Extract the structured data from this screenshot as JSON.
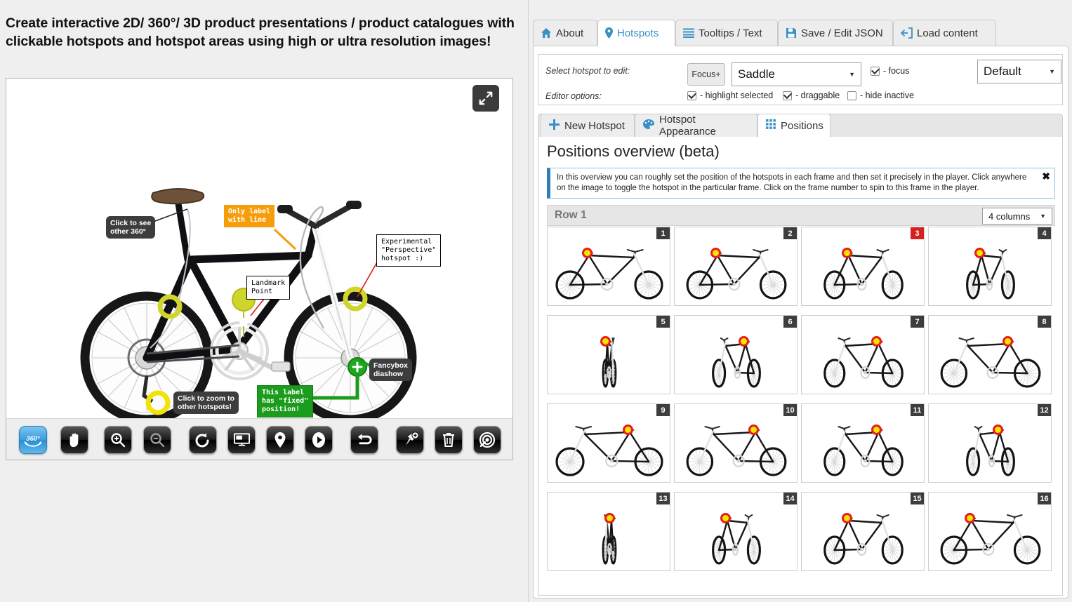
{
  "headline": "Create interactive 2D/ 360°/ 3D product presentations / product catalogues with clickable hotspots and hotspot areas using high or ultra resolution images!",
  "viewer": {
    "fullscreen_icon": "expand-arrows-icon",
    "toolbar": [
      {
        "name": "rotate-360-button",
        "icon": "360-icon",
        "active": true
      },
      {
        "name": "pan-hand-button",
        "icon": "hand-icon",
        "active": false
      },
      {
        "name": "zoom-in-button",
        "icon": "magnifier-plus-icon",
        "active": false
      },
      {
        "name": "zoom-out-button",
        "icon": "magnifier-minus-icon",
        "active": false
      },
      {
        "name": "reset-rotate-button",
        "icon": "rotate-ccw-icon",
        "active": false
      },
      {
        "name": "fullscreen-monitor-button",
        "icon": "monitor-icon",
        "active": false
      },
      {
        "name": "hotspots-toggle-button",
        "icon": "map-pin-icon",
        "active": false
      },
      {
        "name": "play-button",
        "icon": "play-icon",
        "active": false
      },
      {
        "name": "undo-button",
        "icon": "undo-arrow-icon",
        "active": false
      },
      {
        "name": "add-hotspot-button",
        "icon": "pin-plus-icon",
        "active": false
      },
      {
        "name": "delete-button",
        "icon": "trash-icon",
        "active": false
      },
      {
        "name": "target-focus-button",
        "icon": "target-spiral-icon",
        "active": false
      }
    ],
    "labels": [
      {
        "name": "hotspot-label-click-360",
        "text": "Click to see\nother 360°",
        "style": "dark"
      },
      {
        "name": "hotspot-label-only-label-with-line",
        "text": "Only label\nwith line",
        "style": "orange"
      },
      {
        "name": "hotspot-label-landmark-point",
        "text": "Landmark\nPoint",
        "style": "white"
      },
      {
        "name": "hotspot-label-perspective",
        "text": "Experimental\n\"Perspective\"\nhotspot :)",
        "style": "white"
      },
      {
        "name": "hotspot-label-fancybox",
        "text": "Fancybox\ndiashow",
        "style": "dark"
      },
      {
        "name": "hotspot-label-click-zoom",
        "text": "Click to zoom to\nother hotspots!",
        "style": "dark"
      },
      {
        "name": "hotspot-label-fixed-position",
        "text": "This label\nhas \"fixed\"\nposition!",
        "style": "green"
      }
    ]
  },
  "tabs": [
    {
      "label": "About",
      "icon": "home-icon",
      "selected": false
    },
    {
      "label": "Hotspots",
      "icon": "map-pin-icon",
      "selected": true
    },
    {
      "label": "Tooltips / Text",
      "icon": "list-lines-icon",
      "selected": false
    },
    {
      "label": "Save / Edit JSON",
      "icon": "floppy-disk-icon",
      "selected": false
    },
    {
      "label": "Load content",
      "icon": "import-arrow-icon",
      "selected": false
    }
  ],
  "editor": {
    "select_hotspot_label": "Select hotspot to edit:",
    "editor_options_label": "Editor options:",
    "focus_plus_button": "Focus+",
    "hotspot_select_value": "Saddle",
    "focus_checkbox_label": "- focus",
    "focus_checked": true,
    "preset_select_value": "Default",
    "options": [
      {
        "label": "- highlight selected",
        "checked": true,
        "name": "highlight-selected-checkbox"
      },
      {
        "label": "- draggable",
        "checked": true,
        "name": "draggable-checkbox"
      },
      {
        "label": "- hide inactive",
        "checked": false,
        "name": "hide-inactive-checkbox"
      }
    ]
  },
  "subtabs": [
    {
      "label": "New Hotspot",
      "icon": "plus-icon",
      "selected": false
    },
    {
      "label": "Hotspot Appearance",
      "icon": "palette-icon",
      "selected": false
    },
    {
      "label": "Positions",
      "icon": "grid-icon",
      "selected": true
    }
  ],
  "positions": {
    "title": "Positions overview (beta)",
    "info_text": "In this overview you can roughly set the position of the hotspots in each frame and then set it precisely in the player. Click anywhere on the image to toggle the hotspot in the particular frame. Click on the frame number to spin to this frame in the player.",
    "info_close_icon": "close-x-icon",
    "row_label": "Row 1",
    "columns_select_value": "4 columns",
    "frames": [
      {
        "number": "1",
        "current": false,
        "angle": 0
      },
      {
        "number": "2",
        "current": false,
        "angle": 1
      },
      {
        "number": "3",
        "current": true,
        "angle": 2
      },
      {
        "number": "4",
        "current": false,
        "angle": 3
      },
      {
        "number": "5",
        "current": false,
        "angle": 4
      },
      {
        "number": "6",
        "current": false,
        "angle": 5
      },
      {
        "number": "7",
        "current": false,
        "angle": 6
      },
      {
        "number": "8",
        "current": false,
        "angle": 7
      },
      {
        "number": "9",
        "current": false,
        "angle": 8
      },
      {
        "number": "10",
        "current": false,
        "angle": 9
      },
      {
        "number": "11",
        "current": false,
        "angle": 10
      },
      {
        "number": "12",
        "current": false,
        "angle": 11
      },
      {
        "number": "13",
        "current": false,
        "angle": 12
      },
      {
        "number": "14",
        "current": false,
        "angle": 13
      },
      {
        "number": "15",
        "current": false,
        "angle": 14
      },
      {
        "number": "16",
        "current": false,
        "angle": 15
      }
    ]
  },
  "colors": {
    "accent": "#3a8fc8",
    "current_frame": "#d61f1f",
    "hotspot_yellow": "#f2e500",
    "hotspot_ring": "#e81c1c",
    "label_orange": "#f59d0b",
    "label_green": "#1c9c1c"
  }
}
